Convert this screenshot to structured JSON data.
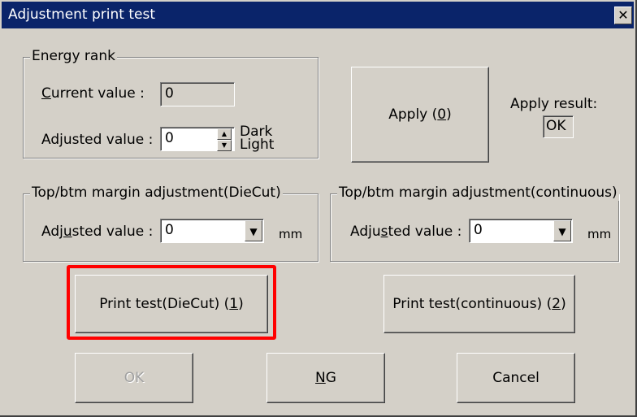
{
  "window": {
    "title": "Adjustment print test",
    "close_glyph": "✕"
  },
  "energy": {
    "group_label": "Energy rank",
    "current_label": "Current value :",
    "current_value": "0",
    "adjusted_label": "Adjusted value :",
    "adjusted_value": "0",
    "dark_label": "Dark",
    "light_label": "Light"
  },
  "apply": {
    "button_label": "Apply (0)",
    "result_label": "Apply result:",
    "result_value": "OK"
  },
  "diecut": {
    "group_label": "Top/btm margin adjustment(DieCut)",
    "adjusted_label": "Adjusted value :",
    "value": "0",
    "unit": "mm"
  },
  "continuous": {
    "group_label": "Top/btm margin adjustment(continuous)",
    "adjusted_label": "Adjusted value :",
    "value": "0",
    "unit": "mm"
  },
  "print_buttons": {
    "diecut": "Print test(DieCut) (1)",
    "continuous": "Print test(continuous) (2)"
  },
  "footer": {
    "ok": "OK",
    "ng": "NG",
    "cancel": "Cancel"
  },
  "colors": {
    "highlight": "#ff0000",
    "titlebar": "#0a246a",
    "face": "#d4d0c8"
  }
}
